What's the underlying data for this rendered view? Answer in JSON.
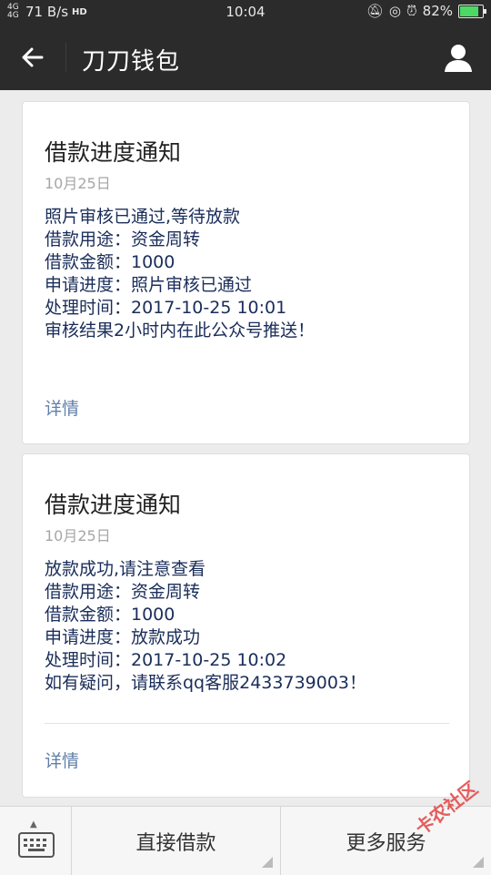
{
  "status": {
    "network": "4G 4G",
    "speed": "71 B/s",
    "hd": "HD",
    "time": "10:04",
    "battery": "82%",
    "battery_level": 0.82
  },
  "appbar": {
    "title": "刀刀钱包",
    "back_icon": "back-arrow-icon",
    "user_icon": "user-icon"
  },
  "cards": [
    {
      "heading": "借款进度通知",
      "date": "10月25日",
      "lines": [
        "照片审核已通过,等待放款",
        "借款用途：资金周转",
        "借款金额：1000",
        "申请进度：照片审核已通过",
        "处理时间：2017-10-25 10:01",
        "审核结果2小时内在此公众号推送！"
      ],
      "detail": "详情"
    },
    {
      "heading": "借款进度通知",
      "date": "10月25日",
      "lines": [
        "放款成功,请注意查看",
        "借款用途：资金周转",
        "借款金额：1000",
        "申请进度：放款成功",
        "处理时间：2017-10-25 10:02",
        "如有疑问，请联系qq客服2433739003！"
      ],
      "detail": "详情"
    }
  ],
  "bottom": {
    "menu1": "直接借款",
    "menu2": "更多服务"
  },
  "watermark": "卡农社区",
  "colors": {
    "bar": "#2b2b2b",
    "text_blue": "#1a2d5a",
    "link": "#5f7fa8"
  }
}
